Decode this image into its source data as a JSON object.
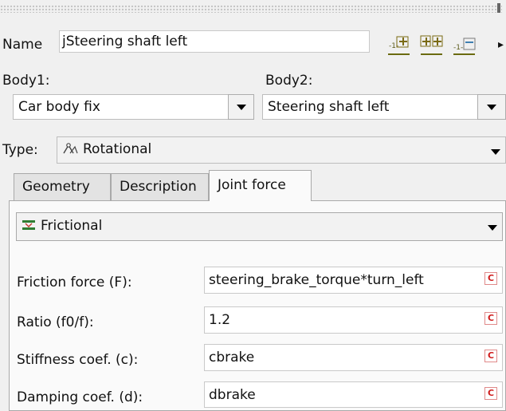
{
  "toolbar": {
    "name_label": "Name",
    "name_value": "jSteering shaft left",
    "more_glyph": "▸"
  },
  "bodies": {
    "body1_label": "Body1:",
    "body1_value": "Car body fix",
    "body2_label": "Body2:",
    "body2_value": "Steering shaft left"
  },
  "type": {
    "label": "Type:",
    "value": "Rotational",
    "icon": "rotational-joint-icon"
  },
  "tabs": [
    {
      "label": "Geometry",
      "active": false
    },
    {
      "label": "Description",
      "active": false
    },
    {
      "label": "Joint force",
      "active": true
    }
  ],
  "force": {
    "type_value": "Frictional",
    "type_icon": "frictional-icon",
    "params": [
      {
        "label": "Friction force (F):",
        "value": "steering_brake_torque*turn_left",
        "btn": "C"
      },
      {
        "label": "Ratio (f0/f):",
        "value": "1.2",
        "btn": "C"
      },
      {
        "label": "Stiffness coef. (c):",
        "value": "cbrake",
        "btn": "C"
      },
      {
        "label": "Damping coef. (d):",
        "value": "dbrake",
        "btn": "C"
      }
    ]
  },
  "colors": {
    "accent_green": "#2f7d32",
    "toolbar_icon_olive": "#8a7a1a",
    "expr_button_red": "#d01c1c"
  }
}
